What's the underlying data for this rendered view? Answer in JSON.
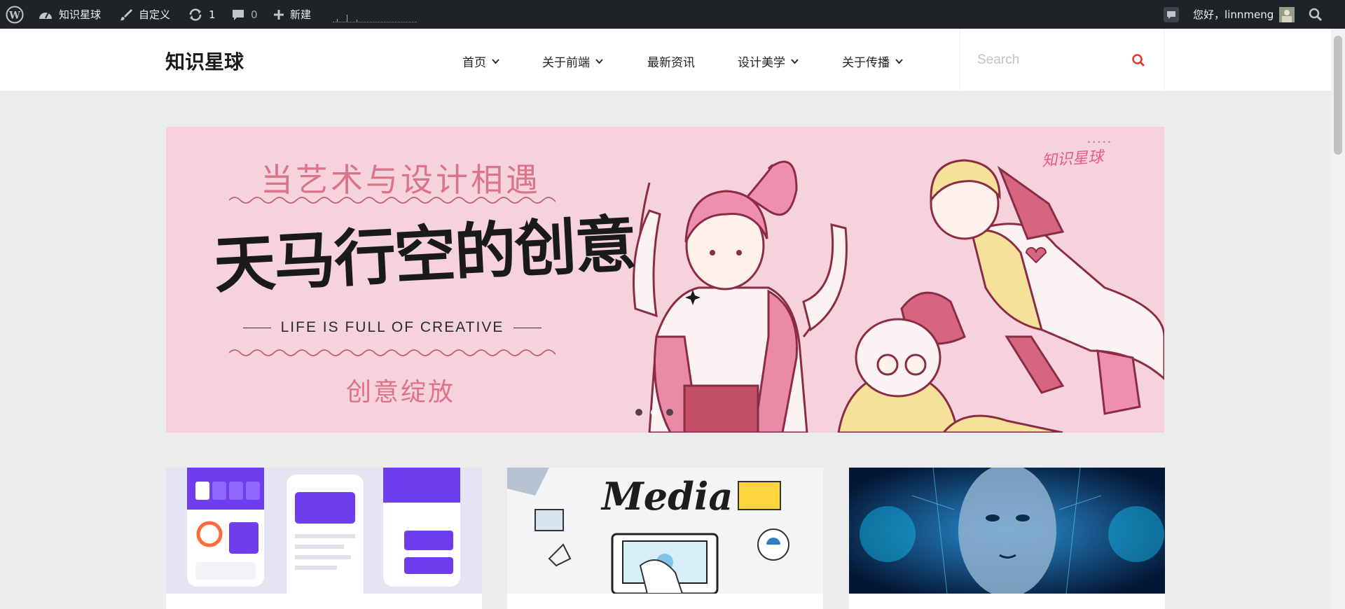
{
  "adminbar": {
    "site_name": "知识星球",
    "customize": "自定义",
    "updates_count": "1",
    "comments_count": "0",
    "new": "新建",
    "greeting": "您好，linnmeng"
  },
  "header": {
    "site_title": "知识星球",
    "nav": [
      {
        "label": "首页",
        "has_dropdown": true
      },
      {
        "label": "关于前端",
        "has_dropdown": true
      },
      {
        "label": "最新资讯",
        "has_dropdown": false
      },
      {
        "label": "设计美学",
        "has_dropdown": true
      },
      {
        "label": "关于传播",
        "has_dropdown": true
      }
    ],
    "search_placeholder": "Search"
  },
  "slider": {
    "top_text": "当艺术与设计相遇",
    "main_text": "天马行空的创意",
    "english_text": "LIFE IS FULL OF CREATIVE",
    "bottom_text": "创意绽放",
    "stamp_text": "知识星球",
    "active_slide": 2,
    "slide_count": 3
  },
  "cards": [
    {
      "thumb": "app-ui-mockup-image"
    },
    {
      "thumb": "media-sketch-image"
    },
    {
      "thumb": "ai-face-image"
    }
  ],
  "colors": {
    "adminbar_bg": "#1d2327",
    "banner_bg": "#f6d2dc",
    "banner_accent": "#db7489",
    "search_icon": "#e03e2d",
    "page_bg": "#ececec"
  }
}
